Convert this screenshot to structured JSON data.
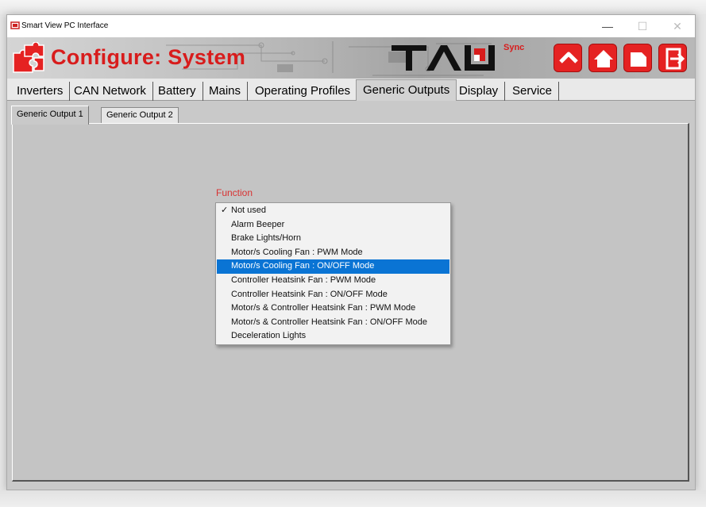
{
  "window": {
    "title": "Smart View PC Interface",
    "minimize": "—",
    "maximize": "☐",
    "close": "✕"
  },
  "header": {
    "title": "Configure: System",
    "brand": "TAU",
    "brand_suffix": "Sync",
    "accent": "#d81c1c",
    "nav_buttons": [
      "up-icon",
      "home-icon",
      "exit-icon",
      "logout-icon"
    ]
  },
  "tabs": [
    "Inverters",
    "CAN Network",
    "Battery",
    "Mains",
    "Operating Profiles",
    "Generic Outputs",
    "Display",
    "Service"
  ],
  "active_tab": "Generic Outputs",
  "subtabs": [
    "Generic Output 1",
    "Generic Output 2"
  ],
  "active_subtab": "Generic Output 1",
  "function": {
    "label": "Function",
    "checked": "Not used",
    "highlighted": "Motor/s Cooling Fan : ON/OFF Mode",
    "check_mark": "✓",
    "options": [
      "Not used",
      "Alarm Beeper",
      "Brake Lights/Horn",
      "Motor/s Cooling Fan : PWM Mode",
      "Motor/s Cooling Fan : ON/OFF Mode",
      "Controller Heatsink Fan : PWM Mode",
      "Controller Heatsink Fan : ON/OFF Mode",
      "Motor/s & Controller Heatsink Fan : PWM Mode",
      "Motor/s & Controller Heatsink Fan : ON/OFF Mode",
      "Deceleration Lights"
    ],
    "highlight_color": "#0a74d4"
  }
}
